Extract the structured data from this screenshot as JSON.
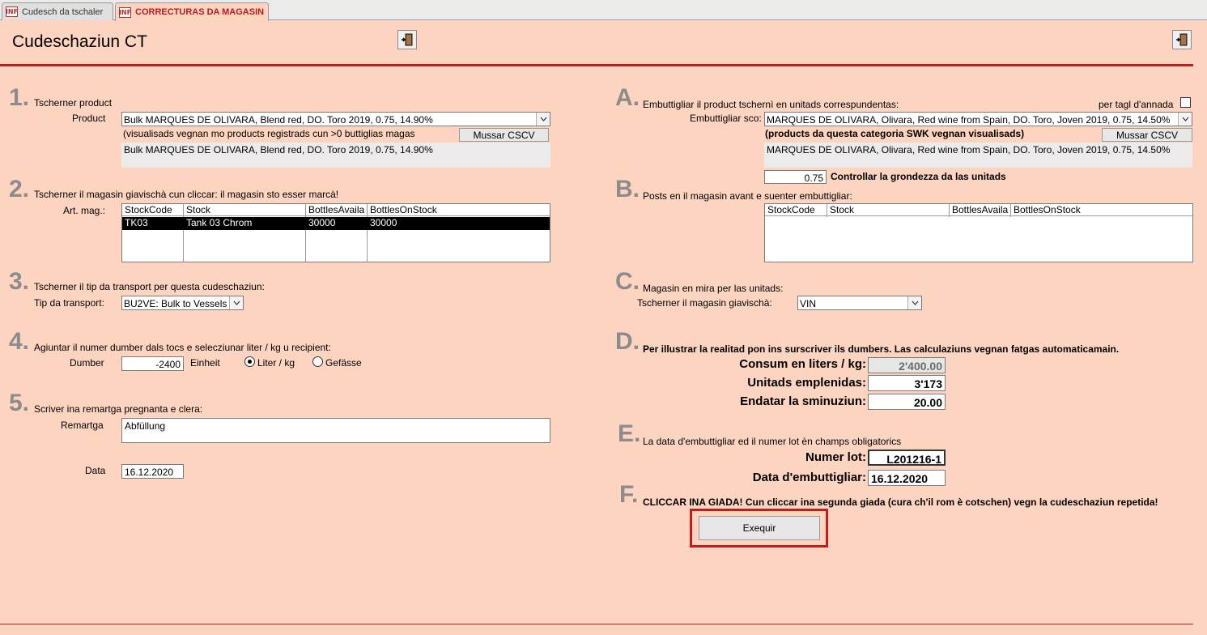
{
  "tabs": [
    {
      "label": "Cudesch da tschaler",
      "icon": "INF"
    },
    {
      "label": "CORRECTURAS DA MAGASIN",
      "icon": "INF"
    }
  ],
  "page_title": "Cudeschaziun CT",
  "colors": {
    "background": "#fdd4c0",
    "accent": "#c01d1d",
    "step_number": "#8c8c8c"
  },
  "left": {
    "s1": {
      "num": "1.",
      "title": "Tscherner product",
      "product_label": "Product",
      "product_value": "Bulk MARQUES DE OLIVARA, Blend red, DO. Toro 2019, 0.75, 14.90%",
      "hint": "(visualisads vegnan mo products registrads cun >0 buttiglias magas",
      "button": "Mussar CSCV",
      "detail": "Bulk MARQUES DE OLIVARA, Blend red, DO. Toro 2019, 0.75, 14.90%"
    },
    "s2": {
      "num": "2.",
      "title": "Tscherner il magasin giavischà cun cliccar: il magasin sto esser marcà!",
      "label": "Art. mag.:",
      "columns": [
        "StockCode",
        "Stock",
        "BottlesAvaila",
        "BottlesOnStock"
      ],
      "rows": [
        [
          "TK03",
          "Tank 03 Chrom",
          "30000",
          "30000"
        ]
      ]
    },
    "s3": {
      "num": "3.",
      "title": "Tscherner il tip da transport per questa cudeschaziun:",
      "label": "Tip da transport:",
      "value": "BU2VE: Bulk to Vessels"
    },
    "s4": {
      "num": "4.",
      "title": "Agiuntar il numer dumber dals tocs e selecziunar liter / kg u recipient:",
      "label": "Dumber",
      "value": "-2400",
      "unit_label": "Einheit",
      "opt1": "Liter / kg",
      "opt2": "Gefässe"
    },
    "s5": {
      "num": "5.",
      "title": "Scriver ina remartga pregnanta e clera:",
      "label": "Remartga",
      "value": "Abfüllung",
      "date_label": "Data",
      "date_value": "16.12.2020"
    }
  },
  "right": {
    "A": {
      "letter": "A.",
      "title": "Embuttigliar il product tschernì en unitads correspundentas:",
      "per_tagl": "per tagl d'annada",
      "label": "Embuttigliar sco:",
      "value": "MARQUES DE OLIVARA, Olivara, Red wine from Spain, DO. Toro, Joven 2019, 0.75, 14.50%",
      "hint": "(products da questa categoria SWK vegnan visualisads)",
      "button": "Mussar CSCV",
      "detail": "MARQUES DE OLIVARA, Olivara, Red wine from Spain, DO. Toro, Joven 2019, 0.75, 14.50%",
      "size_value": "0.75",
      "size_label": "Controllar la grondezza da las unitads"
    },
    "B": {
      "letter": "B.",
      "title": "Posts en il magasin avant e suenter embuttigliar:",
      "columns": [
        "StockCode",
        "Stock",
        "BottlesAvaila",
        "BottlesOnStock"
      ]
    },
    "C": {
      "letter": "C.",
      "title": "Magasin en mira per las unitads:",
      "label": "Tscherner il magasin giavischà:",
      "value": "VIN"
    },
    "D": {
      "letter": "D.",
      "title": "Per illustrar la realitad pon ins surscriver ils dumbers. Las calculaziuns vegnan fatgas automaticamain.",
      "consum_label": "Consum en liters / kg:",
      "consum_value": "2'400.00",
      "unitads_label": "Unitads emplenidas:",
      "unitads_value": "3'173",
      "sminuziun_label": "Endatar la sminuziun:",
      "sminuziun_value": "20.00"
    },
    "E": {
      "letter": "E.",
      "title": "La data d'embuttigliar ed il numer lot èn champs obligatorics",
      "lot_label": "Numer lot:",
      "lot_value": "L201216-1",
      "date_label": "Data d'embuttigliar:",
      "date_value": "16.12.2020"
    },
    "F": {
      "letter": "F.",
      "title": "CLICCAR INA GIADA! Cun cliccar ina segunda giada (cura ch'il rom è cotschen) vegn la cudeschaziun repetida!",
      "button": "Exequir"
    }
  }
}
